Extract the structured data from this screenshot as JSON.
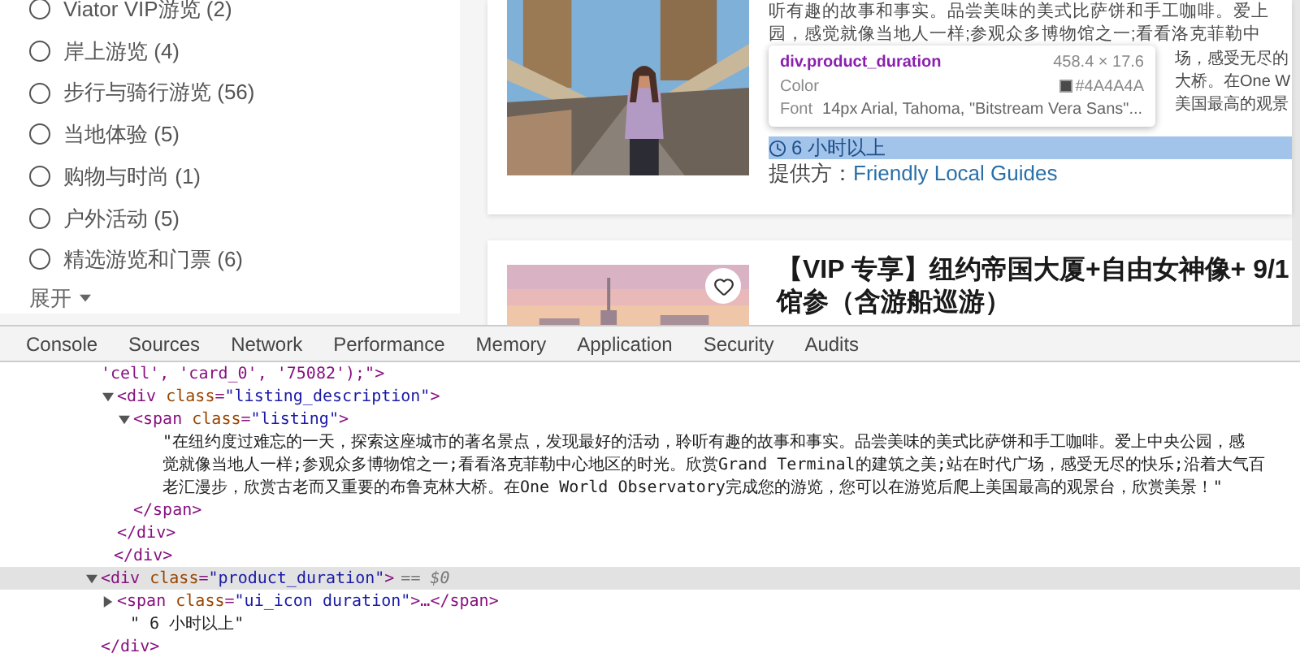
{
  "sidebar": {
    "options": [
      {
        "label": "Viator VIP游览 (2)",
        "selected": false
      },
      {
        "label": "岸上游览 (4)",
        "selected": false
      },
      {
        "label": "步行与骑行游览 (56)",
        "selected": false
      },
      {
        "label": "当地体验 (5)",
        "selected": false
      },
      {
        "label": "购物与时尚 (1)",
        "selected": false
      },
      {
        "label": "户外活动 (5)",
        "selected": false
      },
      {
        "label": "精选游览和门票 (6)",
        "selected": false
      }
    ],
    "expand_label": "展开"
  },
  "cards": [
    {
      "kind": "picture",
      "description_lines": [
        "听有趣的故事和事实。品尝美味的美式比萨饼和手工咖啡。爱上",
        "园，感觉就像当地人一样;参观众多博物馆之一;看看洛克菲勒中"
      ],
      "covered_line_ends": [
        "场，感受无尽的",
        "大桥。在One W",
        "美国最高的观景"
      ],
      "duration": {
        "text": "6 小时以上",
        "highlighted": true
      },
      "provider_label": "提供方：",
      "provider": "Friendly Local Guides",
      "tooltip": {
        "selector": "div.product_duration",
        "size": "458.4 × 17.6",
        "color_label": "Color",
        "color_value": "#4A4A4A",
        "font_label": "Font",
        "font_value": "14px Arial, Tahoma, \"Bitstream Vera Sans\"..."
      }
    },
    {
      "kind": "picture",
      "title_lines": [
        "【VIP 专享】纽约帝国大厦+自由女神像+ 9/1",
        "馆参（含游船巡游）"
      ],
      "favorite": false
    }
  ],
  "devtools": {
    "tabs": [
      "Console",
      "Sources",
      "Network",
      "Performance",
      "Memory",
      "Application",
      "Security",
      "Audits"
    ],
    "dom": [
      {
        "kind": "continuation",
        "open": "'cell', 'card_0', '75082');\">",
        "children": [
          {
            "kind": "element",
            "open": "<div class=\"listing_description\">",
            "expanded": true,
            "children": [
              {
                "kind": "element",
                "open": "<span class=\"listing\">",
                "expanded": true,
                "children": [
                  {
                    "kind": "text",
                    "lines": [
                      "\"在纽约度过难忘的一天，探索这座城市的著名景点，发现最好的活动，聆听有趣的故事和事实。品尝美味的美式比萨饼和手工咖啡。爱上中央公园，感",
                      "觉就像当地人一样;参观众多博物馆之一;看看洛克菲勒中心地区的时光。欣赏Grand Terminal的建筑之美;站在时代广场，感受无尽的快乐;沿着大气百",
                      "老汇漫步，欣赏古老而又重要的布鲁克林大桥。在One World Observatory完成您的游览，您可以在游览后爬上美国最高的观景台，欣赏美景！\""
                    ]
                  }
                ],
                "close": "</span>"
              }
            ],
            "close": "</div>"
          }
        ],
        "close": "</div>"
      },
      {
        "kind": "element",
        "open": "<div class=\"product_duration\">",
        "expanded": true,
        "selected": true,
        "marker": "== $0",
        "children": [
          {
            "kind": "element",
            "open": "<span class=\"ui_icon duration\">…</span>",
            "expanded": false
          },
          {
            "kind": "text",
            "lines": [
              "\" 6 小时以上\""
            ]
          }
        ],
        "close": "</div>"
      }
    ]
  }
}
